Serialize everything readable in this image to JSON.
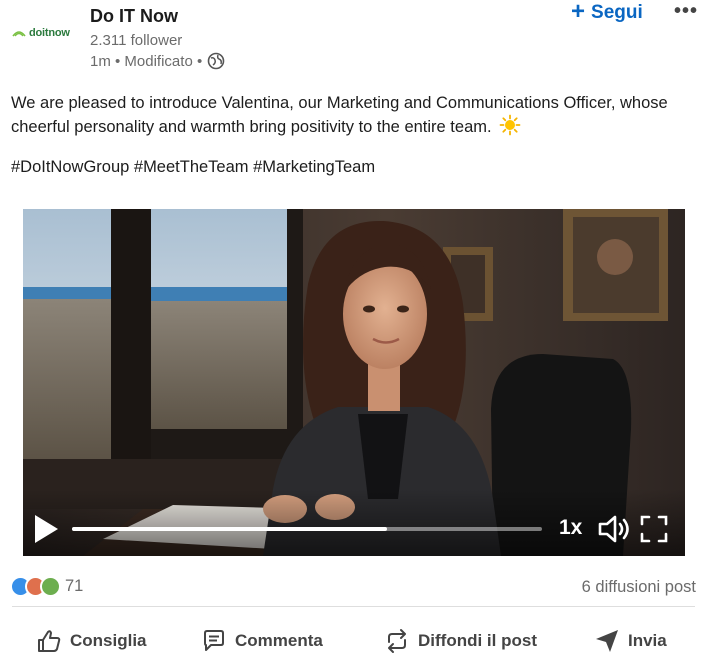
{
  "post": {
    "company_logo_text": "doitnow",
    "company_name": "Do IT Now",
    "followers": "2.311 follower",
    "meta": "1m • Modificato •",
    "follow_label": "Segui",
    "follow_plus": "+",
    "more_label": "•••",
    "body": "We are pleased to introduce Valentina, our Marketing and Communications Officer, whose cheerful personality and warmth bring positivity to the entire team.",
    "emoji_icon": "sun-emoji",
    "hashtags": "#DoItNowGroup #MeetTheTeam #MarketingTeam"
  },
  "video": {
    "speed": "1x",
    "progress": 0.67,
    "icons": [
      "play-icon",
      "volume-icon",
      "fullscreen-icon"
    ]
  },
  "social": {
    "reaction_count": "71",
    "reposts": "6 diffusioni post",
    "reaction_icons": [
      "like-icon",
      "celebrate-icon",
      "support-icon"
    ],
    "colors": {
      "like": "#378fe9",
      "celebrate": "#df704d",
      "support": "#6dae4f"
    }
  },
  "actions": {
    "like": "Consiglia",
    "comment": "Commenta",
    "repost": "Diffondi il post",
    "send": "Invia"
  },
  "colors": {
    "accent": "#0a66c2",
    "brand_green": "#2b7a3d",
    "muted_text": "#6b6b6b"
  }
}
